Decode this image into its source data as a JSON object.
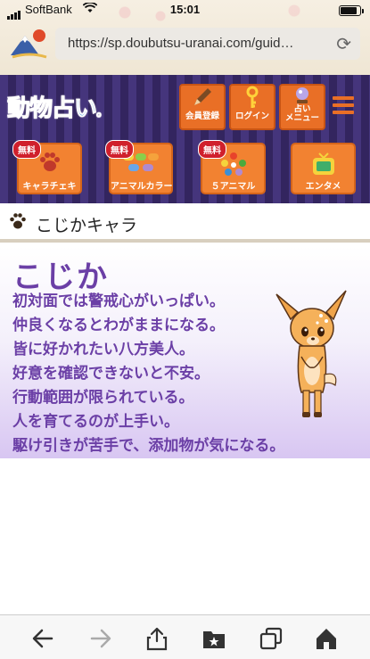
{
  "status_bar": {
    "carrier": "SoftBank",
    "time": "15:01",
    "battery_level": 0.85
  },
  "browser": {
    "url": "https://sp.doubutsu-uranai.com/guid…"
  },
  "site": {
    "logo": "動物占い",
    "header_buttons": [
      {
        "label": "会員登録",
        "icon": "pencil-icon"
      },
      {
        "label": "ログイン",
        "icon": "key-icon"
      },
      {
        "label": "占い\nメニュー",
        "icon": "crystal-ball-icon"
      }
    ],
    "tiles": [
      {
        "label": "キャラチェキ",
        "badge": "無料",
        "icon": "paw-icon"
      },
      {
        "label": "アニマルカラー",
        "badge": "無料",
        "icon": "color-dots-icon"
      },
      {
        "label": "５アニマル",
        "badge": "無料",
        "icon": "five-animals-icon"
      },
      {
        "label": "エンタメ",
        "badge": "",
        "icon": "tv-icon"
      }
    ]
  },
  "section": {
    "title": "こじかキャラ",
    "icon": "paw-icon"
  },
  "character": {
    "name": "こじか",
    "traits": [
      "初対面では警戒心がいっぱい。",
      "仲良くなるとわがままになる。",
      "皆に好かれたい八方美人。",
      "好意を確認できないと不安。",
      "行動範囲が限られている。",
      "人を育てるのが上手い。",
      "駆け引きが苦手で、添加物が気になる。"
    ]
  },
  "toolbar": {
    "buttons": [
      "back-arrow-icon",
      "forward-arrow-icon",
      "share-icon",
      "bookmarks-icon",
      "tabs-icon",
      "home-icon"
    ]
  },
  "colors": {
    "header_bg": "#3b2c6e",
    "accent_orange": "#e96f26",
    "trait_purple": "#6b3fa6"
  }
}
